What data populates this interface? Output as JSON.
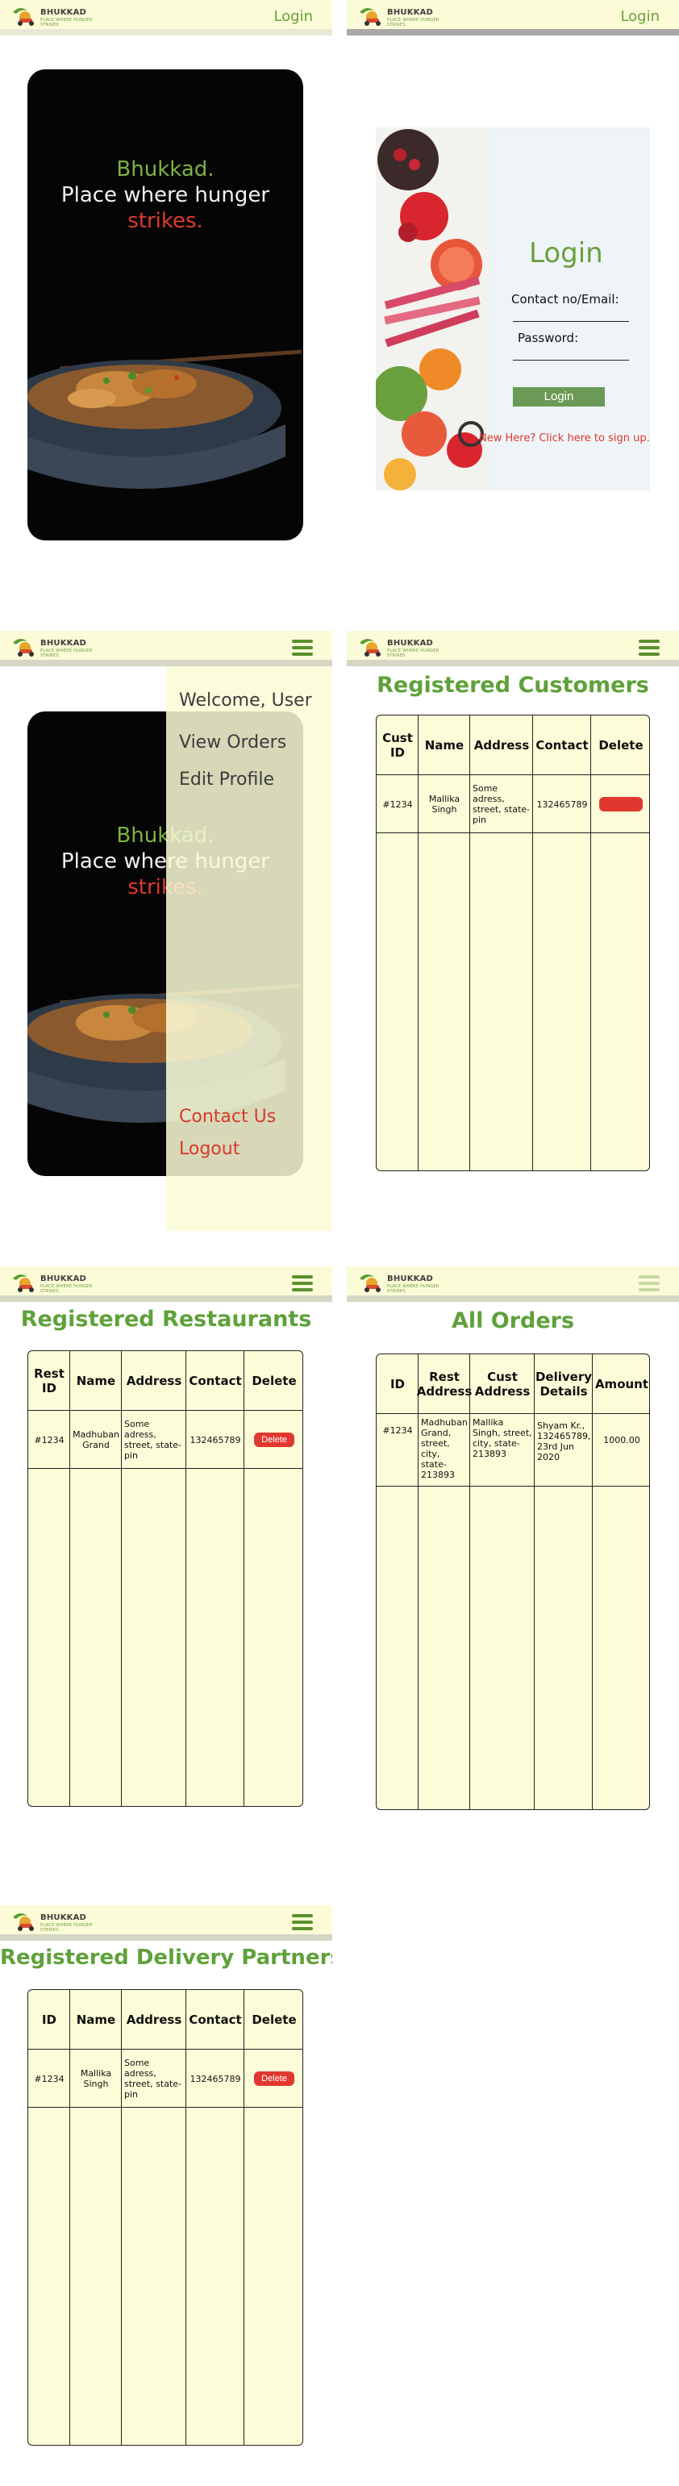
{
  "brand": {
    "name": "BHUKKAD",
    "tagline": "PLACE WHERE HUNGER STRIKES"
  },
  "header": {
    "login_label": "Login"
  },
  "hero": {
    "line1": "Bhukkad.",
    "line2": "Place where hunger",
    "line3": "strikes."
  },
  "login": {
    "title": "Login",
    "contact_label": "Contact no/Email:",
    "password_label": "Password:",
    "button_label": "Login",
    "signup_text": "New Here? Click here to sign up."
  },
  "menu": {
    "welcome": "Welcome, User",
    "view_orders": "View Orders",
    "edit_profile": "Edit Profile",
    "contact_us": "Contact Us",
    "logout": "Logout"
  },
  "customers": {
    "title": "Registered Customers",
    "headers": [
      "Cust ID",
      "Name",
      "Address",
      "Contact",
      "Delete"
    ],
    "row": {
      "id": "#1234",
      "name": "Mallika Singh",
      "address": "Some adress, street, state-pin",
      "contact": "132465789",
      "delete": ""
    }
  },
  "restaurants": {
    "title": "Registered Restaurants",
    "headers": [
      "Rest ID",
      "Name",
      "Address",
      "Contact",
      "Delete"
    ],
    "row": {
      "id": "#1234",
      "name": "Madhuban Grand",
      "address": "Some adress, street, state-pin",
      "contact": "132465789",
      "delete": "Delete"
    }
  },
  "orders": {
    "title": "All Orders",
    "headers": [
      "ID",
      "Rest Address",
      "Cust Address",
      "Delivery Details",
      "Amount"
    ],
    "row": {
      "id": "#1234",
      "rest": "Madhuban Grand, street, city, state-213893",
      "cust": "Mallika Singh, street, city, state-213893",
      "delivery": "Shyam Kr., 132465789, 23rd Jun 2020",
      "amount": "1000.00"
    }
  },
  "partners": {
    "title": "Registered Delivery Partners",
    "headers": [
      "ID",
      "Name",
      "Address",
      "Contact",
      "Delete"
    ],
    "row": {
      "id": "#1234",
      "name": "Mallika Singh",
      "address": "Some adress, street, state-pin",
      "contact": "132465789",
      "delete": "Delete"
    }
  },
  "icons": {
    "logo": "scooter-logo-icon",
    "menu": "hamburger-menu-icon"
  },
  "colors": {
    "accent_green": "#6aa03e",
    "header_bg": "#fbfbd8",
    "danger_red": "#e0382f",
    "table_bg": "#fcfdd8"
  }
}
